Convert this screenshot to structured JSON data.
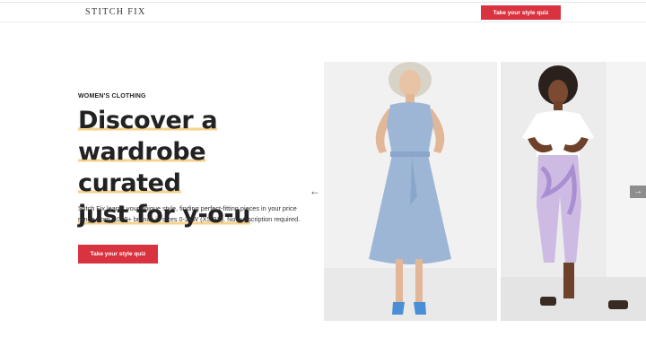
{
  "nav": {
    "logo": "STITCH FIX",
    "cta_label": "Take your style quiz"
  },
  "hero": {
    "eyebrow": "WOMEN'S CLOTHING",
    "headline_lines": [
      "Discover a",
      "wardrobe curated",
      "just for y-o-u"
    ],
    "body": "Stitch Fix learns your unique style, finding perfect-fitting pieces in your price range from 1,000+ brands in sizes 0-24W (XS-3X). No subscription required.",
    "cta_label": "Take your style quiz"
  },
  "carousel": {
    "prev_icon": "arrow-left-icon",
    "next_icon": "arrow-right-icon",
    "prev_glyph": "←",
    "next_glyph": "→"
  },
  "colors": {
    "brand_red": "#d9333f",
    "highlight": "#f6d28b",
    "arrow_bg": "#8d8d8d"
  }
}
